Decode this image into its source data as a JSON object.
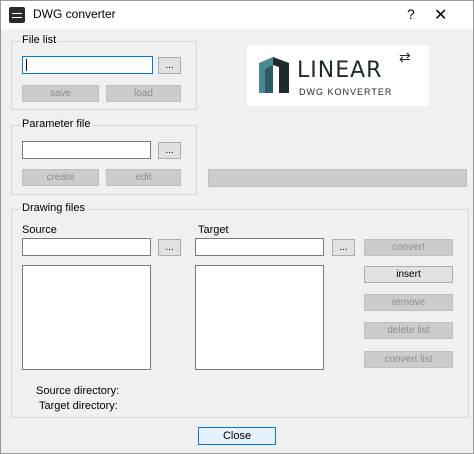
{
  "window": {
    "title": "DWG converter",
    "help_glyph": "?",
    "close_glyph": "✕"
  },
  "file_list": {
    "group_title": "File list",
    "path_value": "",
    "browse_label": "...",
    "save_label": "save",
    "load_label": "load"
  },
  "parameter_file": {
    "group_title": "Parameter file",
    "path_value": "",
    "browse_label": "...",
    "create_label": "create",
    "edit_label": "edit"
  },
  "logo": {
    "name": "LINEAR",
    "subtitle": "DWG KONVERTER",
    "swap_glyph": "⇄"
  },
  "status_bar_text": "",
  "drawing_files": {
    "group_title": "Drawing files",
    "source_label": "Source",
    "target_label": "Target",
    "browse_label": "...",
    "convert_label": "convert",
    "insert_label": "insert",
    "remove_label": "remove",
    "delete_list_label": "delete list",
    "convert_list_label": "convert list",
    "source_directory_label": "Source directory:",
    "target_directory_label": "Target directory:"
  },
  "close_label": "Close",
  "colors": {
    "accent": "#0078d7",
    "logo_dark": "#1f2a2c",
    "logo_teal": "#4a8a94"
  }
}
